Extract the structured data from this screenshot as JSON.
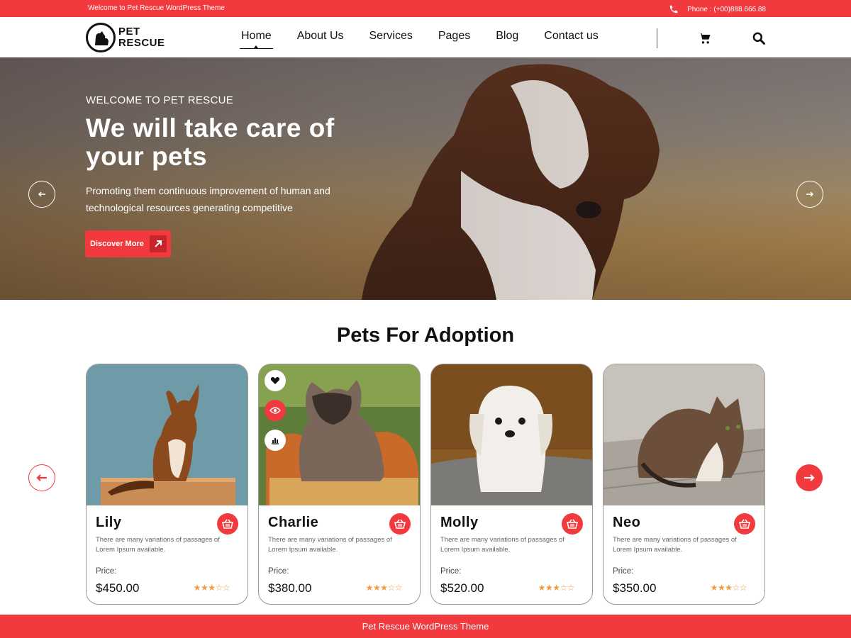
{
  "topbar": {
    "welcome": "Welcome to Pet Rescue WordPress Theme",
    "phone": "Phone : (+00)888.666.88"
  },
  "header": {
    "logo_line1": "PET",
    "logo_line2": "RESCUE",
    "nav": [
      "Home",
      "About Us",
      "Services",
      "Pages",
      "Blog",
      "Contact us"
    ]
  },
  "hero": {
    "subtitle": "WELCOME TO PET RESCUE",
    "title": "We will take care of your pets",
    "text": "Promoting them continuous improvement of human and technological resources generating competitive",
    "button": "Discover More"
  },
  "section": {
    "title": "Pets For Adoption"
  },
  "pets": [
    {
      "name": "Lily",
      "desc": "There are many variations of passages of Lorem Ipsum available.",
      "price_label": "Price:",
      "price": "$450.00",
      "rating": 3,
      "max": 5
    },
    {
      "name": "Charlie",
      "desc": "There are many variations of passages of Lorem Ipsum available.",
      "price_label": "Price:",
      "price": "$380.00",
      "rating": 3,
      "max": 5
    },
    {
      "name": "Molly",
      "desc": "There are many variations of passages of Lorem Ipsum available.",
      "price_label": "Price:",
      "price": "$520.00",
      "rating": 3,
      "max": 5
    },
    {
      "name": "Neo",
      "desc": "There are many variations of passages of Lorem Ipsum available.",
      "price_label": "Price:",
      "price": "$350.00",
      "rating": 3,
      "max": 5
    }
  ],
  "footer": {
    "text": "Pet Rescue WordPress Theme"
  },
  "colors": {
    "accent": "#f2393e",
    "star": "#f29a3a"
  }
}
